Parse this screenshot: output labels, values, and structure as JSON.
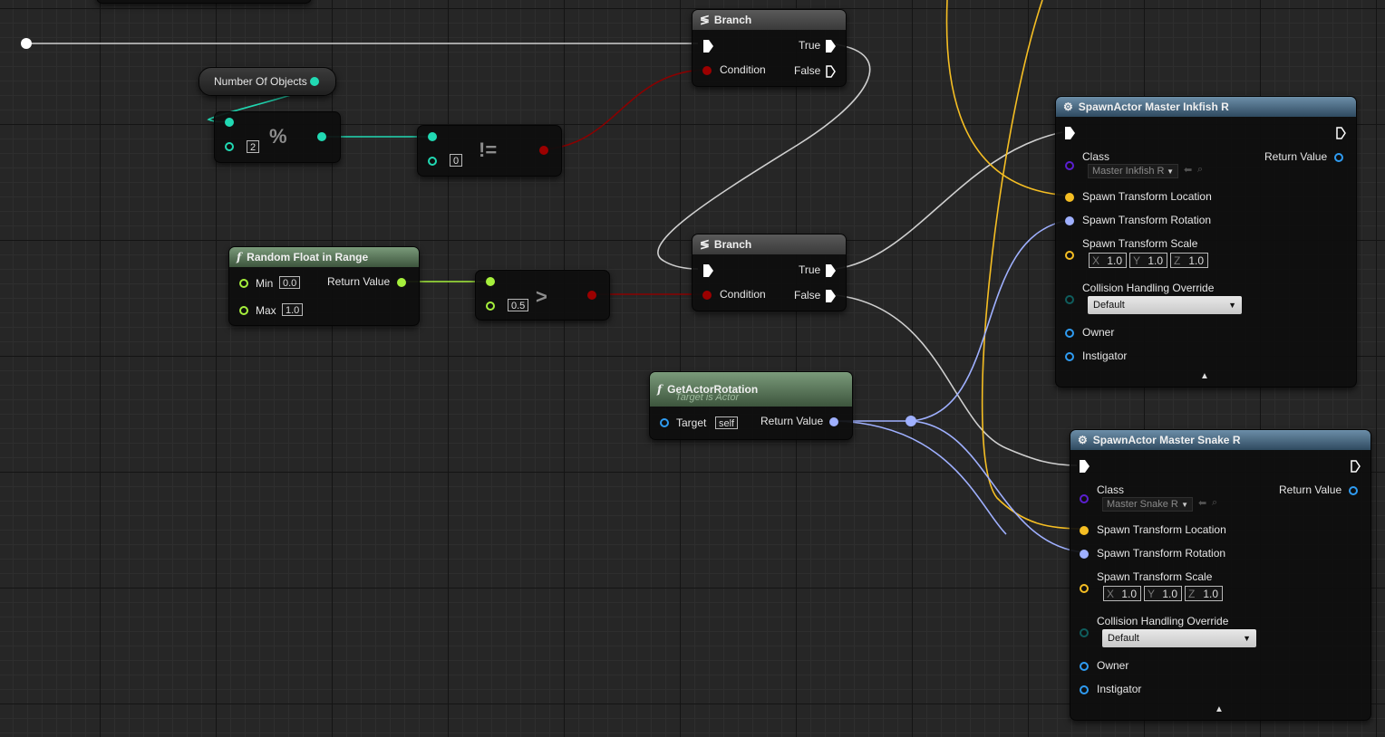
{
  "colors": {
    "exec": "#ffffff",
    "bool": "#9c0000",
    "int": "#21d9b3",
    "float": "#a6f03c",
    "vector": "#f5be23",
    "rotator": "#9fb0ff",
    "transform": "#f49e2c",
    "object": "#2f9cf2",
    "class": "#5b1fd1",
    "enum": "#0f5d5d",
    "wire_exec": "#cfcfcf"
  },
  "number_of_objects": {
    "label": "Number Of Objects"
  },
  "modulo": {
    "operator": "%",
    "b_value": "2"
  },
  "not_equal": {
    "operator": "!=",
    "b_value": "0"
  },
  "branch_top": {
    "title": "Branch",
    "true_label": "True",
    "false_label": "False",
    "condition_label": "Condition"
  },
  "branch_bottom": {
    "title": "Branch",
    "true_label": "True",
    "false_label": "False",
    "condition_label": "Condition"
  },
  "random_float": {
    "title": "Random Float in Range",
    "min_label": "Min",
    "min_value": "0.0",
    "max_label": "Max",
    "max_value": "1.0",
    "return_label": "Return Value"
  },
  "greater": {
    "operator": ">",
    "b_value": "0.5"
  },
  "get_actor_rotation": {
    "title": "GetActorRotation",
    "subtitle": "Target is Actor",
    "target_label": "Target",
    "target_value": "self",
    "return_label": "Return Value"
  },
  "spawn_inkfish": {
    "title": "SpawnActor Master Inkfish R",
    "class_label": "Class",
    "class_value": "Master Inkfish R",
    "return_label": "Return Value",
    "loc_label": "Spawn Transform Location",
    "rot_label": "Spawn Transform Rotation",
    "scale_label": "Spawn Transform Scale",
    "scale_x": "1.0",
    "scale_y": "1.0",
    "scale_z": "1.0",
    "collision_label": "Collision Handling Override",
    "collision_value": "Default",
    "owner_label": "Owner",
    "instigator_label": "Instigator"
  },
  "spawn_snake": {
    "title": "SpawnActor Master Snake R",
    "class_label": "Class",
    "class_value": "Master Snake R",
    "return_label": "Return Value",
    "loc_label": "Spawn Transform Location",
    "rot_label": "Spawn Transform Rotation",
    "scale_label": "Spawn Transform Scale",
    "scale_x": "1.0",
    "scale_y": "1.0",
    "scale_z": "1.0",
    "collision_label": "Collision Handling Override",
    "collision_value": "Default",
    "owner_label": "Owner",
    "instigator_label": "Instigator"
  },
  "axis_labels": {
    "x": "X",
    "y": "Y",
    "z": "Z"
  }
}
